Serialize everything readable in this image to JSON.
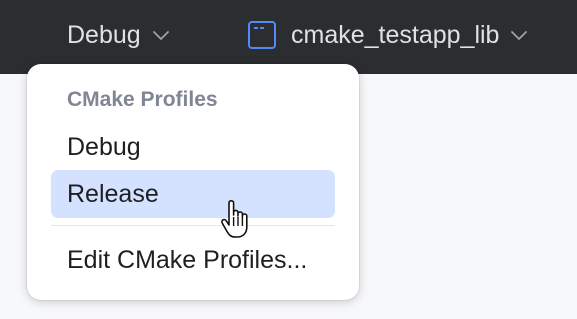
{
  "toolbar": {
    "profile_label": "Debug",
    "profile_chevron_icon": "chevron-down-icon",
    "target_icon": "cmake-target-icon",
    "target_label": "cmake_testapp_lib",
    "target_chevron_icon": "chevron-down-icon"
  },
  "popup": {
    "header": "CMake Profiles",
    "items": [
      {
        "label": "Debug",
        "selected": false
      },
      {
        "label": "Release",
        "selected": true
      },
      {
        "label": "Edit CMake Profiles...",
        "selected": false
      }
    ]
  },
  "cursor": "hand-pointer-icon",
  "colors": {
    "toolbar_bg": "#2b2d30",
    "toolbar_text": "#dfe1e5",
    "highlight": "#d4e2ff",
    "header_text": "#818594",
    "accent": "#548af7"
  }
}
